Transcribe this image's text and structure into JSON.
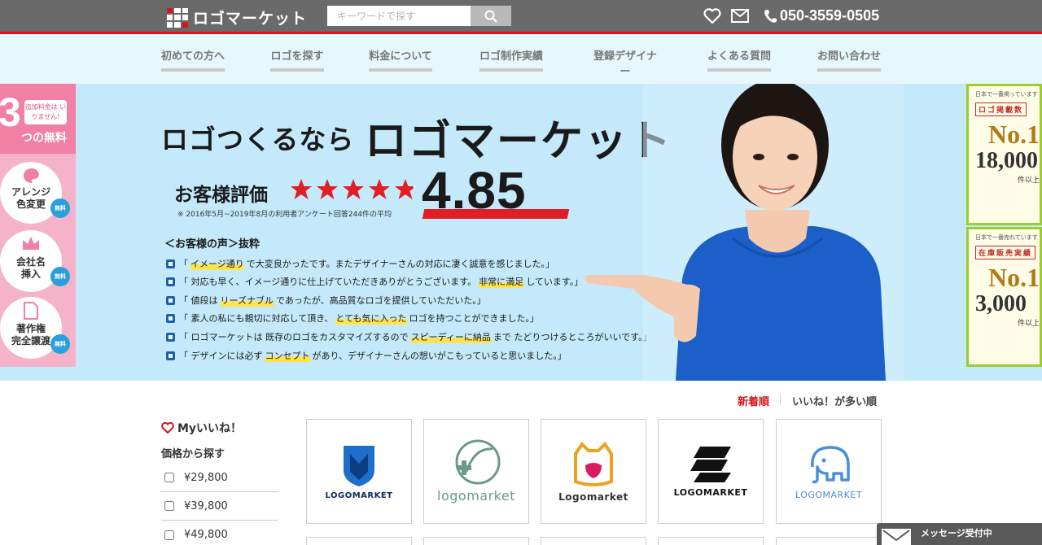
{
  "header": {
    "logo_text": "ロゴマーケット",
    "search_placeholder": "キーワードで探す",
    "phone": "050-3559-0505"
  },
  "nav": {
    "items": [
      {
        "label": "初めての方へ"
      },
      {
        "label": "ロゴを探す"
      },
      {
        "label": "料金について"
      },
      {
        "label": "ロゴ制作実績"
      },
      {
        "label": "登録デザイナー"
      },
      {
        "label": "よくある質問"
      },
      {
        "label": "お問い合わせ"
      }
    ]
  },
  "free_panel": {
    "big": "3",
    "note": "追加料金は いりません!",
    "label": "つの無料",
    "items": [
      {
        "label": "アレンジ\n色変更",
        "badge": "無料"
      },
      {
        "label": "会社名\n挿入",
        "badge": "無料"
      },
      {
        "label": "著作権\n完全譲渡",
        "badge": "無料"
      }
    ]
  },
  "hero": {
    "lead": "ロゴつくるなら",
    "brand": "ロゴマーケット",
    "rating_label": "お客様評価",
    "rating_value": 4.85,
    "score_text": "4.85",
    "note": "※ 2016年5月~2019年8月の利用者アンケート回答244件の平均",
    "voice_title": "＜お客様の声＞抜粋",
    "reviews": [
      {
        "pre": "「",
        "mark": "イメージ通り",
        "post": "で大変良かったです。またデザイナーさんの対応に凄く誠意を感じました。」"
      },
      {
        "pre": "「 対応も早く、イメージ通りに仕上げていただきありがとうございます。",
        "mark": "非常に満足",
        "post": "しています。」"
      },
      {
        "pre": "「 値段は",
        "mark": "リーズナブル",
        "post": "であったが、高品質なロゴを提供していただいた。」"
      },
      {
        "pre": "「 素人の私にも親切に対応して頂き、",
        "mark": "とても気に入った",
        "post": "ロゴを持つことができました。」"
      },
      {
        "pre": "「 ロゴマーケットは 既存のロゴをカスタマイズするので",
        "mark": "スピーディーに納品",
        "post": "まで たどりつけるところがいいです。」"
      },
      {
        "pre": "「 デザインには必ず",
        "mark": "コンセプト",
        "post": "があり、デザイナーさんの想いがこもっていると思いました。」"
      }
    ]
  },
  "right_banners": [
    {
      "top": "日本で一番掲っています",
      "tag": "ロゴ掲載数",
      "no1": "No.1",
      "num": "18,000",
      "unit": "件以上"
    },
    {
      "top": "日本で一番売れています",
      "tag": "在庫販売実績",
      "no1": "No.1",
      "num": "3,000",
      "unit": "件以上"
    }
  ],
  "sort": {
    "newest": "新着順",
    "popular": "いいね！が多い順"
  },
  "sidebar": {
    "likes": "Myいいね！",
    "price_title": "価格から探す",
    "prices": [
      "¥29,800",
      "¥39,800",
      "¥49,800"
    ]
  },
  "products": [
    {
      "name": "LOGOMARKET"
    },
    {
      "name": "logomarket"
    },
    {
      "name": "Logomarket"
    },
    {
      "name": "LOGOMARKET"
    },
    {
      "name": "LOGOMARKET"
    }
  ],
  "chat": {
    "label": "メッセージ受付中"
  },
  "colors": {
    "accent": "#d9141a",
    "hero_bg": "#c3e9fb",
    "nav_bg": "#e6f7fd"
  }
}
